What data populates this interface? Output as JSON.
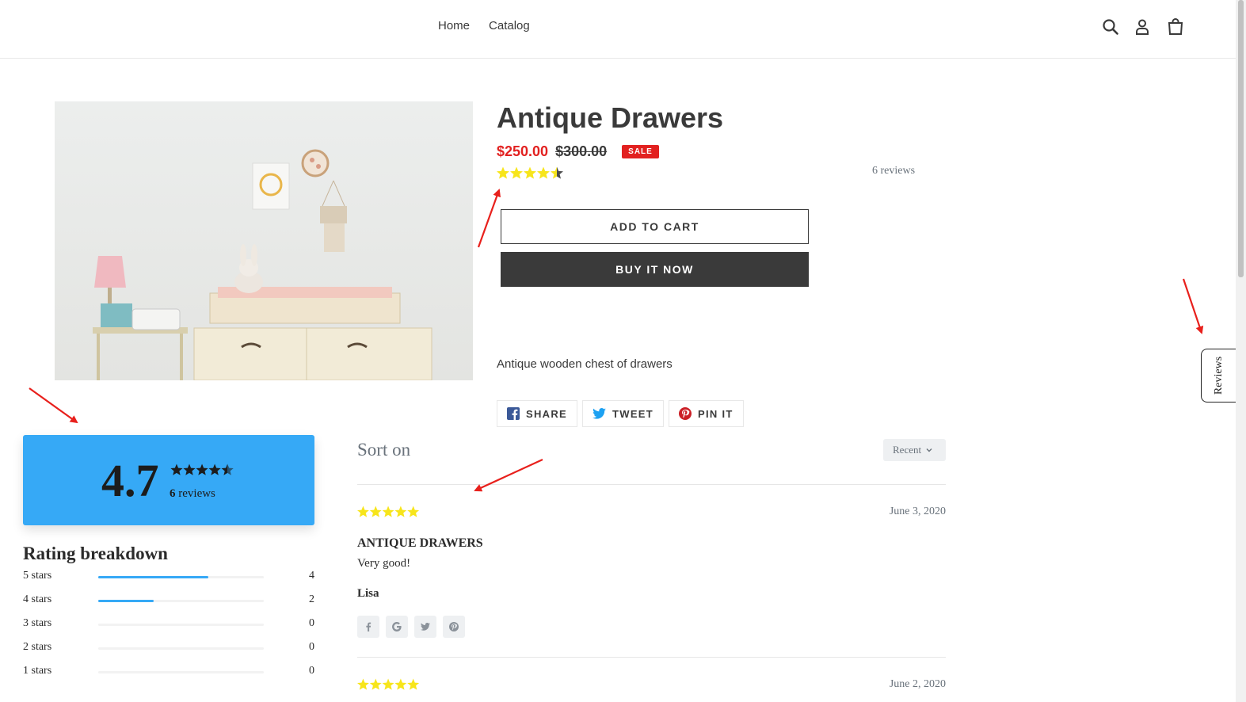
{
  "header": {
    "nav": [
      "Home",
      "Catalog"
    ],
    "icons": [
      "search-icon",
      "account-icon",
      "cart-icon"
    ]
  },
  "product": {
    "title": "Antique Drawers",
    "price_sale": "$250.00",
    "price_regular": "$300.00",
    "sale_badge": "SALE",
    "rating": 4.7,
    "reviews_link": "6 reviews",
    "add_to_cart": "ADD TO CART",
    "buy_now": "BUY IT NOW",
    "description": "Antique wooden chest of drawers",
    "share": [
      {
        "label": "SHARE",
        "icon": "facebook-icon"
      },
      {
        "label": "TWEET",
        "icon": "twitter-icon"
      },
      {
        "label": "PIN IT",
        "icon": "pinterest-icon"
      }
    ]
  },
  "side_tab": {
    "label": "Reviews"
  },
  "summary": {
    "average": "4.7",
    "count": "6",
    "count_suffix": " reviews"
  },
  "breakdown": {
    "title": "Rating breakdown",
    "rows": [
      {
        "label": "5 stars",
        "count": "4",
        "fraction": 0.667
      },
      {
        "label": "4 stars",
        "count": "2",
        "fraction": 0.333
      },
      {
        "label": "3 stars",
        "count": "0",
        "fraction": 0
      },
      {
        "label": "2 stars",
        "count": "0",
        "fraction": 0
      },
      {
        "label": "1 stars",
        "count": "0",
        "fraction": 0
      }
    ]
  },
  "reviews_list": {
    "sort_label": "Sort on",
    "sort_value": "Recent",
    "items": [
      {
        "stars": 5,
        "date": "June 3, 2020",
        "title": "ANTIQUE DRAWERS",
        "body": "Very good!",
        "author": "Lisa"
      },
      {
        "stars": 5,
        "date": "June 2, 2020"
      }
    ],
    "share_icons": [
      "facebook-icon",
      "google-icon",
      "twitter-icon",
      "pinterest-icon"
    ]
  },
  "colors": {
    "sale_red": "#e22120",
    "star_yellow": "#f7e51b",
    "summary_blue": "#36a9f6",
    "dark": "#3a3a3a",
    "annotation_red": "#e8201c"
  }
}
